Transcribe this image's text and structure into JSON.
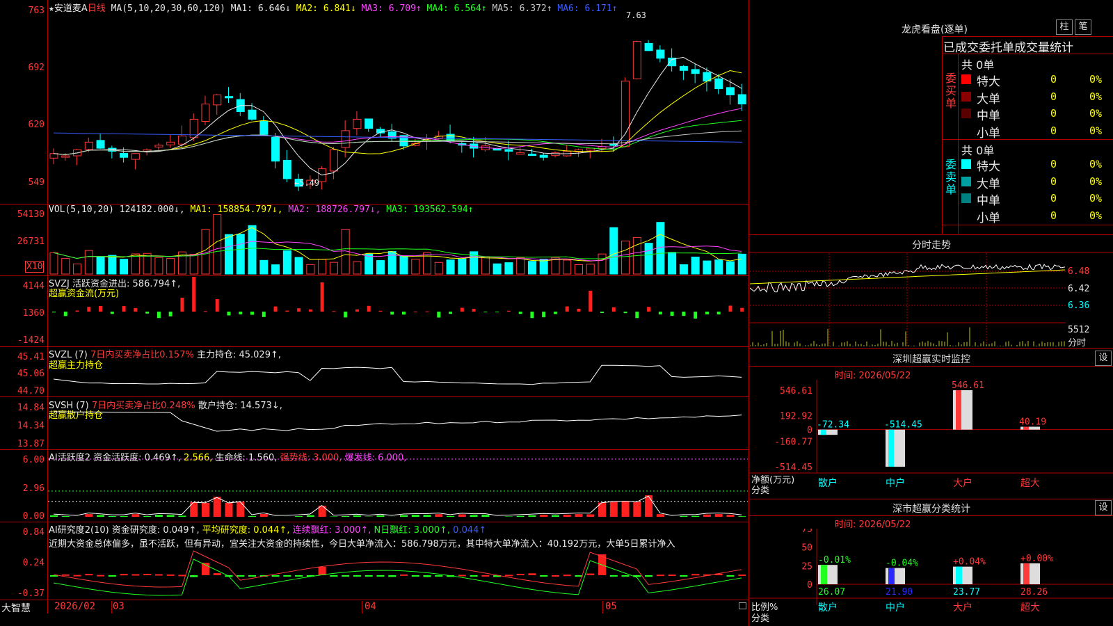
{
  "stock": {
    "star": "★",
    "name": "安道麦A",
    "period": "日线"
  },
  "ma_legend": {
    "label": "MA(5,10,20,30,60,120)",
    "items": [
      {
        "text": "MA1: 6.646↓",
        "color": "#e8e8e8"
      },
      {
        "text": "MA2: 6.841↓",
        "color": "#ffff00"
      },
      {
        "text": "MA3: 6.709↑",
        "color": "#ff44ff"
      },
      {
        "text": "MA4: 6.564↑",
        "color": "#20ff20"
      },
      {
        "text": "MA5: 6.372↑",
        "color": "#c8c8c8"
      },
      {
        "text": "MA6: 6.171↑",
        "color": "#3a5bff"
      }
    ]
  },
  "price_axis": [
    "763",
    "692",
    "620",
    "549"
  ],
  "price_marks": {
    "high": "7.63",
    "low": "←5.49"
  },
  "vol": {
    "label": "VOL(5,10,20)",
    "value": "124182.000↓,",
    "ma1": "MA1: 158854.797↓,",
    "ma2": "MA2: 188726.797↓,",
    "ma3": "MA3: 193562.594↑",
    "axis": [
      "54130",
      "26731"
    ],
    "unit": "X10"
  },
  "svzj": {
    "label": "SVZJ  活跃资金进出: 586.794↑,",
    "sub": "超赢资金流(万元)",
    "axis": [
      "4144",
      "1360",
      "-1424"
    ]
  },
  "svzl": {
    "label": "SVZL (7)",
    "ratio": "7日内买卖净占比0.157%",
    "hold": "主力持仓: 45.029↑,",
    "sub": "超赢主力持仓",
    "axis": [
      "45.41",
      "45.06",
      "44.70"
    ]
  },
  "svsh": {
    "label": "SVSH (7)",
    "ratio": "7日内买卖净占比0.248%",
    "hold": "散户持仓: 14.573↓,",
    "sub": "超赢散户持仓",
    "axis": [
      "14.84",
      "14.34",
      "13.87"
    ]
  },
  "ai1": {
    "label": "AI活跃度2",
    "act": "资金活跃度: 0.469↑,",
    "v2": "2.566,",
    "life": "生命线: 1.560,",
    "strong": "强势线: 3.000,",
    "burst": "爆发线: 6.000,",
    "axis": [
      "6.00",
      "2.96",
      "0.00"
    ]
  },
  "ai2": {
    "label": "AI研究度2(10)",
    "r1": "资金研究度: 0.049↑,",
    "r2": "平均研究度: 0.044↑,",
    "r3": "连续飘红: 3.000↑,",
    "r4": "N日飘红: 3.000↑,",
    "r5": "0.044↑",
    "axis": [
      "0.84",
      "0.24",
      "-0.37"
    ],
    "comment": "近期大资金总体偏多，虽不活跃，但有异动，宜关注大资金的持续性，今日大单净流入：586.798万元，其中特大单净流入：40.192万元，大单5日累计净入"
  },
  "dates": {
    "brand": "大智慧",
    "d1": "2026/02",
    "d2": "03",
    "d3": "04",
    "d4": "05"
  },
  "lhb": {
    "title": "龙虎看盘(逐单)",
    "btn1": "柱",
    "btn2": "笔",
    "header": "已成交委托单成交量统计",
    "buy": {
      "side": "委买单",
      "total": "共 0单",
      "rows": [
        {
          "name": "特大",
          "val": "0",
          "pct": "0%",
          "color": "#ff0000"
        },
        {
          "name": "大单",
          "val": "0",
          "pct": "0%",
          "color": "#8a0000"
        },
        {
          "name": "中单",
          "val": "0",
          "pct": "0%",
          "color": "#5a0000"
        },
        {
          "name": "小单",
          "val": "0",
          "pct": "0%",
          "color": "#000000"
        }
      ]
    },
    "sell": {
      "side": "委卖单",
      "total": "共 0单",
      "rows": [
        {
          "name": "特大",
          "val": "0",
          "pct": "0%",
          "color": "#00ffff"
        },
        {
          "name": "大单",
          "val": "0",
          "pct": "0%",
          "color": "#00a0a0"
        },
        {
          "name": "中单",
          "val": "0",
          "pct": "0%",
          "color": "#008080"
        },
        {
          "name": "小单",
          "val": "0",
          "pct": "0%",
          "color": "#000000"
        }
      ]
    }
  },
  "fenshi": {
    "title": "分时走势",
    "axis": [
      "6.48",
      "6.42",
      "6.36"
    ],
    "vol": "5512",
    "vol_label": "分时"
  },
  "monitor": {
    "title": "深圳超赢实时监控",
    "set": "设",
    "time": "时间: 2026/05/22",
    "axis": [
      "546.61",
      "192.92",
      "0",
      "-160.77",
      "-514.45"
    ],
    "net_label": "净额(万元)",
    "cat_label": "分类"
  },
  "classify": {
    "title": "深市超赢分类统计",
    "set": "设",
    "time": "时间: 2026/05/22",
    "axis": [
      "75",
      "50",
      "25",
      "0"
    ],
    "ratio_label": "比例%",
    "cat_label": "分类"
  },
  "chart_data": [
    {
      "type": "bar",
      "title": "深圳超赢实时监控",
      "categories": [
        "散户",
        "中户",
        "大户",
        "超大"
      ],
      "values": [
        -72.34,
        -514.45,
        546.61,
        40.19
      ],
      "value_labels": [
        "-72.34",
        "-514.45",
        "546.61",
        "40.19"
      ],
      "ylabel": "净额(万元)",
      "ylim": [
        -514.45,
        546.61
      ],
      "colors": [
        "#00ffff",
        "#00ffff",
        "#ff3a3a",
        "#ff3a3a"
      ]
    },
    {
      "type": "bar",
      "title": "深市超赢分类统计",
      "categories": [
        "散户",
        "中户",
        "大户",
        "超大"
      ],
      "values": [
        26.07,
        21.9,
        23.77,
        28.26
      ],
      "value_labels": [
        "26.07",
        "21.90",
        "23.77",
        "28.26"
      ],
      "changes": [
        "-0.01%",
        "-0.04%",
        "+0.04%",
        "+0.00%"
      ],
      "ylabel": "比例%",
      "ylim": [
        0,
        75
      ],
      "colors": [
        "#20ff20",
        "#2a2aff",
        "#00ffff",
        "#ff3a3a"
      ]
    }
  ],
  "colors": {
    "up": "#ff3a3a",
    "down": "#00ffff",
    "grid": "#b00000"
  }
}
